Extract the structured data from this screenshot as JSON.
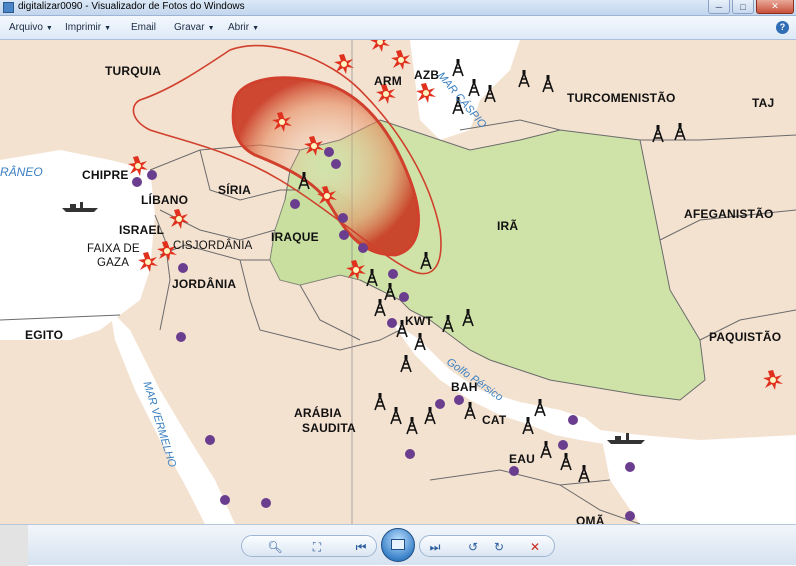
{
  "window": {
    "title": "digitalizar0090 - Visualizador de Fotos do Windows",
    "buttons": {
      "minimize": "─",
      "maximize": "□",
      "close": "✕"
    }
  },
  "menu": {
    "items": [
      {
        "label": "Arquivo",
        "has_dropdown": true
      },
      {
        "label": "Imprimir",
        "has_dropdown": true
      },
      {
        "label": "Email",
        "has_dropdown": false
      },
      {
        "label": "Gravar",
        "has_dropdown": true
      },
      {
        "label": "Abrir",
        "has_dropdown": true
      }
    ],
    "help_label": "?"
  },
  "map": {
    "countries": {
      "turquia": "TURQUIA",
      "arm": "ARM",
      "azb": "AZB",
      "turcomenistao": "TURCOMENISTÃO",
      "taj": "TAJ",
      "chipre": "CHIPRE",
      "libano": "LÍBANO",
      "siria": "SÍRIA",
      "israel": "ISRAEL",
      "cisjordania": "CISJORDÂNIA",
      "faixa_gaza_1": "FAIXA DE",
      "faixa_gaza_2": "GAZA",
      "jordania": "JORDÂNIA",
      "iraque": "IRAQUE",
      "ira": "IRÃ",
      "afeganistao": "AFEGANISTÃO",
      "egito": "EGITO",
      "kwt": "KWT",
      "paquistao": "PAQUISTÃO",
      "bah": "BAH",
      "cat": "CAT",
      "arabia_1": "ARÁBIA",
      "arabia_2": "SAUDITA",
      "eau": "EAU",
      "oma": "OMÃ"
    },
    "water": {
      "mediterraneo": "RÂNEO",
      "caspio": "MAR CÁSPIO",
      "golfo": "Golfo Pérsico",
      "vermelho": "MAR VERMELHO"
    },
    "colors": {
      "land": "#f4e2d1",
      "highlight": "#cfe3a8",
      "sea": "#ffffff",
      "border": "#6b6b6b",
      "kurdish_outline": "#d0402c",
      "explosion": "#e0301e",
      "dot": "#6a3d8f"
    }
  },
  "toolbar": {
    "zoom": "zoom-icon",
    "fit": "actual-size-icon",
    "previous": "previous-icon",
    "slideshow": "slideshow-icon",
    "next": "next-icon",
    "rotate_left": "rotate-ccw-icon",
    "rotate_right": "rotate-cw-icon",
    "delete": "delete-icon"
  }
}
